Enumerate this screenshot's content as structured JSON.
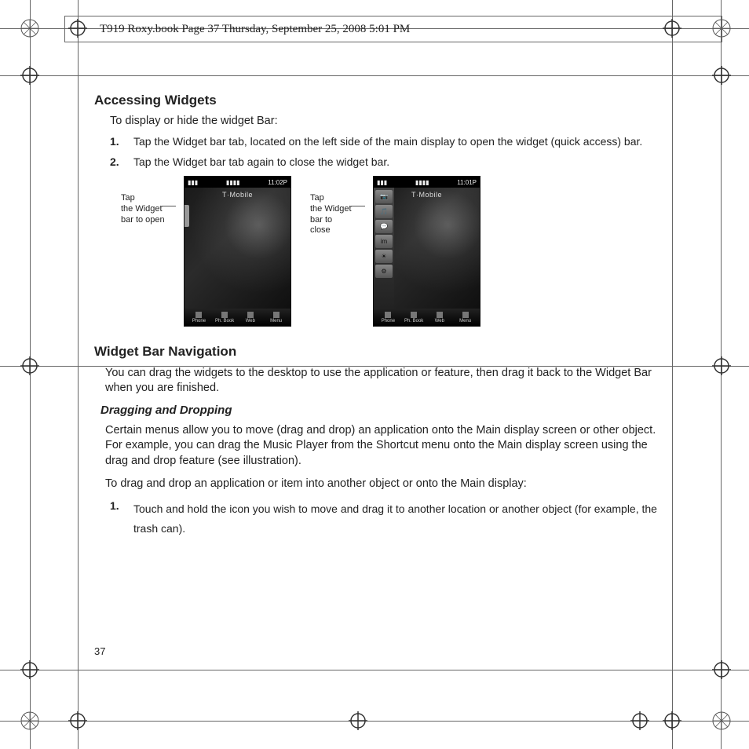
{
  "header": {
    "banner": "T919 Roxy.book  Page 37  Thursday, September 25, 2008  5:01 PM"
  },
  "page": {
    "number": "37"
  },
  "section1": {
    "title": "Accessing Widgets",
    "intro": "To display or hide the widget Bar:",
    "steps": [
      {
        "n": "1.",
        "t": "Tap the Widget bar tab, located on the left side of the main display to open the widget (quick access) bar."
      },
      {
        "n": "2.",
        "t": "Tap the Widget bar tab again to close the widget bar."
      }
    ]
  },
  "figs": {
    "left_label_l1": "Tap",
    "left_label_l2": "the Widget",
    "left_label_l3": "bar to open",
    "right_label_l1": "Tap",
    "right_label_l2": "the Widget",
    "right_label_l3": "bar to close",
    "phone": {
      "signal": "▮▮▮",
      "batt": "▮▮▮▮",
      "time1": "11:02P",
      "time2": "11:01P",
      "carrier": "T·Mobile",
      "dock": [
        "Phone",
        "Ph. Book",
        "Web",
        "Menu"
      ],
      "widgets": [
        "📷",
        "🎵",
        "💬",
        "im",
        "☀",
        "⚙"
      ]
    }
  },
  "section2": {
    "title": "Widget Bar Navigation",
    "p1": "You can drag the widgets to the desktop to use the application or feature, then drag it back to the Widget Bar when you are finished.",
    "sub": "Dragging and Dropping",
    "p2": "Certain menus allow you to move (drag and drop) an application onto the Main display screen or other object. For example, you can drag the Music Player from the Shortcut menu onto the Main display screen using the drag and drop feature (see illustration).",
    "p3": "To drag and drop an application or item into another object or onto the Main display:",
    "steps": [
      {
        "n": "1.",
        "t": "Touch and hold the icon you wish to move and drag it to another location or another object (for example, the trash can)."
      }
    ]
  }
}
